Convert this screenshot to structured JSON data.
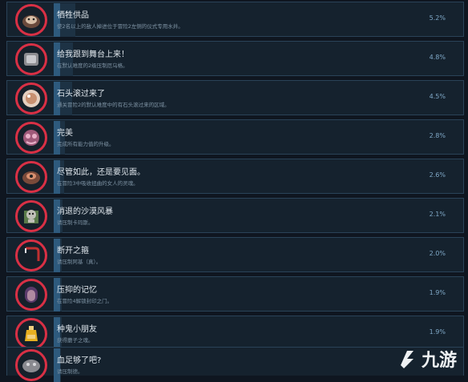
{
  "achievements": [
    {
      "title": "牺牲供品",
      "desc": "使2名以上的敌人掉进位于冒险2左侧的仪式专用水井。",
      "percent": "5.2%",
      "fill": 0.052,
      "icon": "pig-icon",
      "colors": [
        "#6a4a3c",
        "#d8c0a8"
      ]
    },
    {
      "title": "给我跟到舞台上来！",
      "desc": "在默认难度的2级压制厄乌格。",
      "percent": "4.8%",
      "fill": 0.048,
      "icon": "stone-box-icon",
      "colors": [
        "#8c8c90",
        "#c8c8cc"
      ]
    },
    {
      "title": "石头滚过来了",
      "desc": "通关冒险2的默认难度中的有石头滚过来的区域。",
      "percent": "4.5%",
      "fill": 0.045,
      "icon": "boulder-icon",
      "colors": [
        "#c89070",
        "#e6d0c0"
      ]
    },
    {
      "title": "完美",
      "desc": "完成所有能力值的升级。",
      "percent": "2.8%",
      "fill": 0.028,
      "icon": "pink-mask-icon",
      "colors": [
        "#a05a7a",
        "#e8b0c8"
      ]
    },
    {
      "title": "尽管如此，还是要见面。",
      "desc": "在冒险3中吸收扭曲的女人的灵魂。",
      "percent": "2.6%",
      "fill": 0.026,
      "icon": "twisted-woman-icon",
      "colors": [
        "#7a4a3a",
        "#d89070"
      ]
    },
    {
      "title": "消退的沙漠风暴",
      "desc": "请压制卡玛斯。",
      "percent": "2.1%",
      "fill": 0.021,
      "icon": "skeleton-icon",
      "colors": [
        "#c0c0b8",
        "#5a7a4a"
      ]
    },
    {
      "title": "断开之箍",
      "desc": "请压制阿基（真）。",
      "percent": "2.0%",
      "fill": 0.02,
      "icon": "hook-icon",
      "colors": [
        "#c03030",
        "#e0e0e8"
      ]
    },
    {
      "title": "压抑的记忆",
      "desc": "在冒险4解锁封印之门。",
      "percent": "1.9%",
      "fill": 0.019,
      "icon": "sealed-door-icon",
      "colors": [
        "#5a3a6a",
        "#b08aa0"
      ]
    },
    {
      "title": "种鬼小朋友",
      "desc": "获得蘑子之魂。",
      "percent": "1.9%",
      "fill": 0.019,
      "icon": "flask-icon",
      "colors": [
        "#e8b020",
        "#f0d080"
      ]
    },
    {
      "title": "血足够了吧?",
      "desc": "请压制德。",
      "percent": "",
      "fill": 0.017,
      "icon": "creature-icon",
      "colors": [
        "#8a8a90",
        "#d8d8dc"
      ]
    }
  ],
  "watermark": {
    "text": "九游",
    "icon": "jiuyou-logo-icon"
  }
}
